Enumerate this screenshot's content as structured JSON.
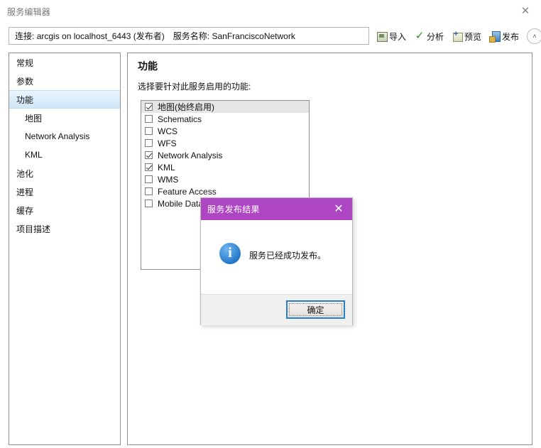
{
  "window": {
    "title": "服务编辑器",
    "close_label": "✕",
    "close_icon": "close-icon"
  },
  "toolbar": {
    "connection": {
      "connection_label": "连接:",
      "connection_value": "arcgis on localhost_6443 (发布者)",
      "service_label": "服务名称:",
      "service_value": "SanFranciscoNetwork"
    },
    "buttons": [
      {
        "label": "导入",
        "icon": "import-icon"
      },
      {
        "label": "分析",
        "icon": "checkmark-icon"
      },
      {
        "label": "预览",
        "icon": "preview-icon"
      },
      {
        "label": "发布",
        "icon": "publish-icon"
      }
    ],
    "collapse": {
      "label": "˄",
      "icon": "chevron-up-icon"
    }
  },
  "sidebar": {
    "items": [
      {
        "label": "常规",
        "sub": false,
        "selected": false
      },
      {
        "label": "参数",
        "sub": false,
        "selected": false
      },
      {
        "label": "功能",
        "sub": false,
        "selected": true
      },
      {
        "label": "地图",
        "sub": true,
        "selected": false
      },
      {
        "label": "Network Analysis",
        "sub": true,
        "selected": false
      },
      {
        "label": "KML",
        "sub": true,
        "selected": false
      },
      {
        "label": "池化",
        "sub": false,
        "selected": false
      },
      {
        "label": "进程",
        "sub": false,
        "selected": false
      },
      {
        "label": "缓存",
        "sub": false,
        "selected": false
      },
      {
        "label": "项目描述",
        "sub": false,
        "selected": false
      }
    ]
  },
  "content": {
    "title": "功能",
    "description": "选择要针对此服务启用的功能:",
    "capabilities": [
      {
        "label": "地图(始终启用)",
        "checked": true,
        "highlighted": true
      },
      {
        "label": "Schematics",
        "checked": false,
        "highlighted": false
      },
      {
        "label": "WCS",
        "checked": false,
        "highlighted": false
      },
      {
        "label": "WFS",
        "checked": false,
        "highlighted": false
      },
      {
        "label": "Network Analysis",
        "checked": true,
        "highlighted": false
      },
      {
        "label": "KML",
        "checked": true,
        "highlighted": false
      },
      {
        "label": "WMS",
        "checked": false,
        "highlighted": false
      },
      {
        "label": "Feature Access",
        "checked": false,
        "highlighted": false
      },
      {
        "label": "Mobile Data",
        "checked": false,
        "highlighted": false
      }
    ]
  },
  "dialog": {
    "title": "服务发布结果",
    "close_label": "✕",
    "close_icon": "close-icon",
    "info_icon": "info-icon",
    "info_glyph": "i",
    "message": "服务已经成功发布。",
    "ok_label": "确定"
  },
  "colors": {
    "dialog_accent": "#ae46c4",
    "info_blue": "#1f74c8",
    "focus_blue": "#2a7fc9",
    "sidebar_selection": "#cfe6f7",
    "row_highlight": "#e6e6e6",
    "check_green": "#2e8b1f"
  }
}
